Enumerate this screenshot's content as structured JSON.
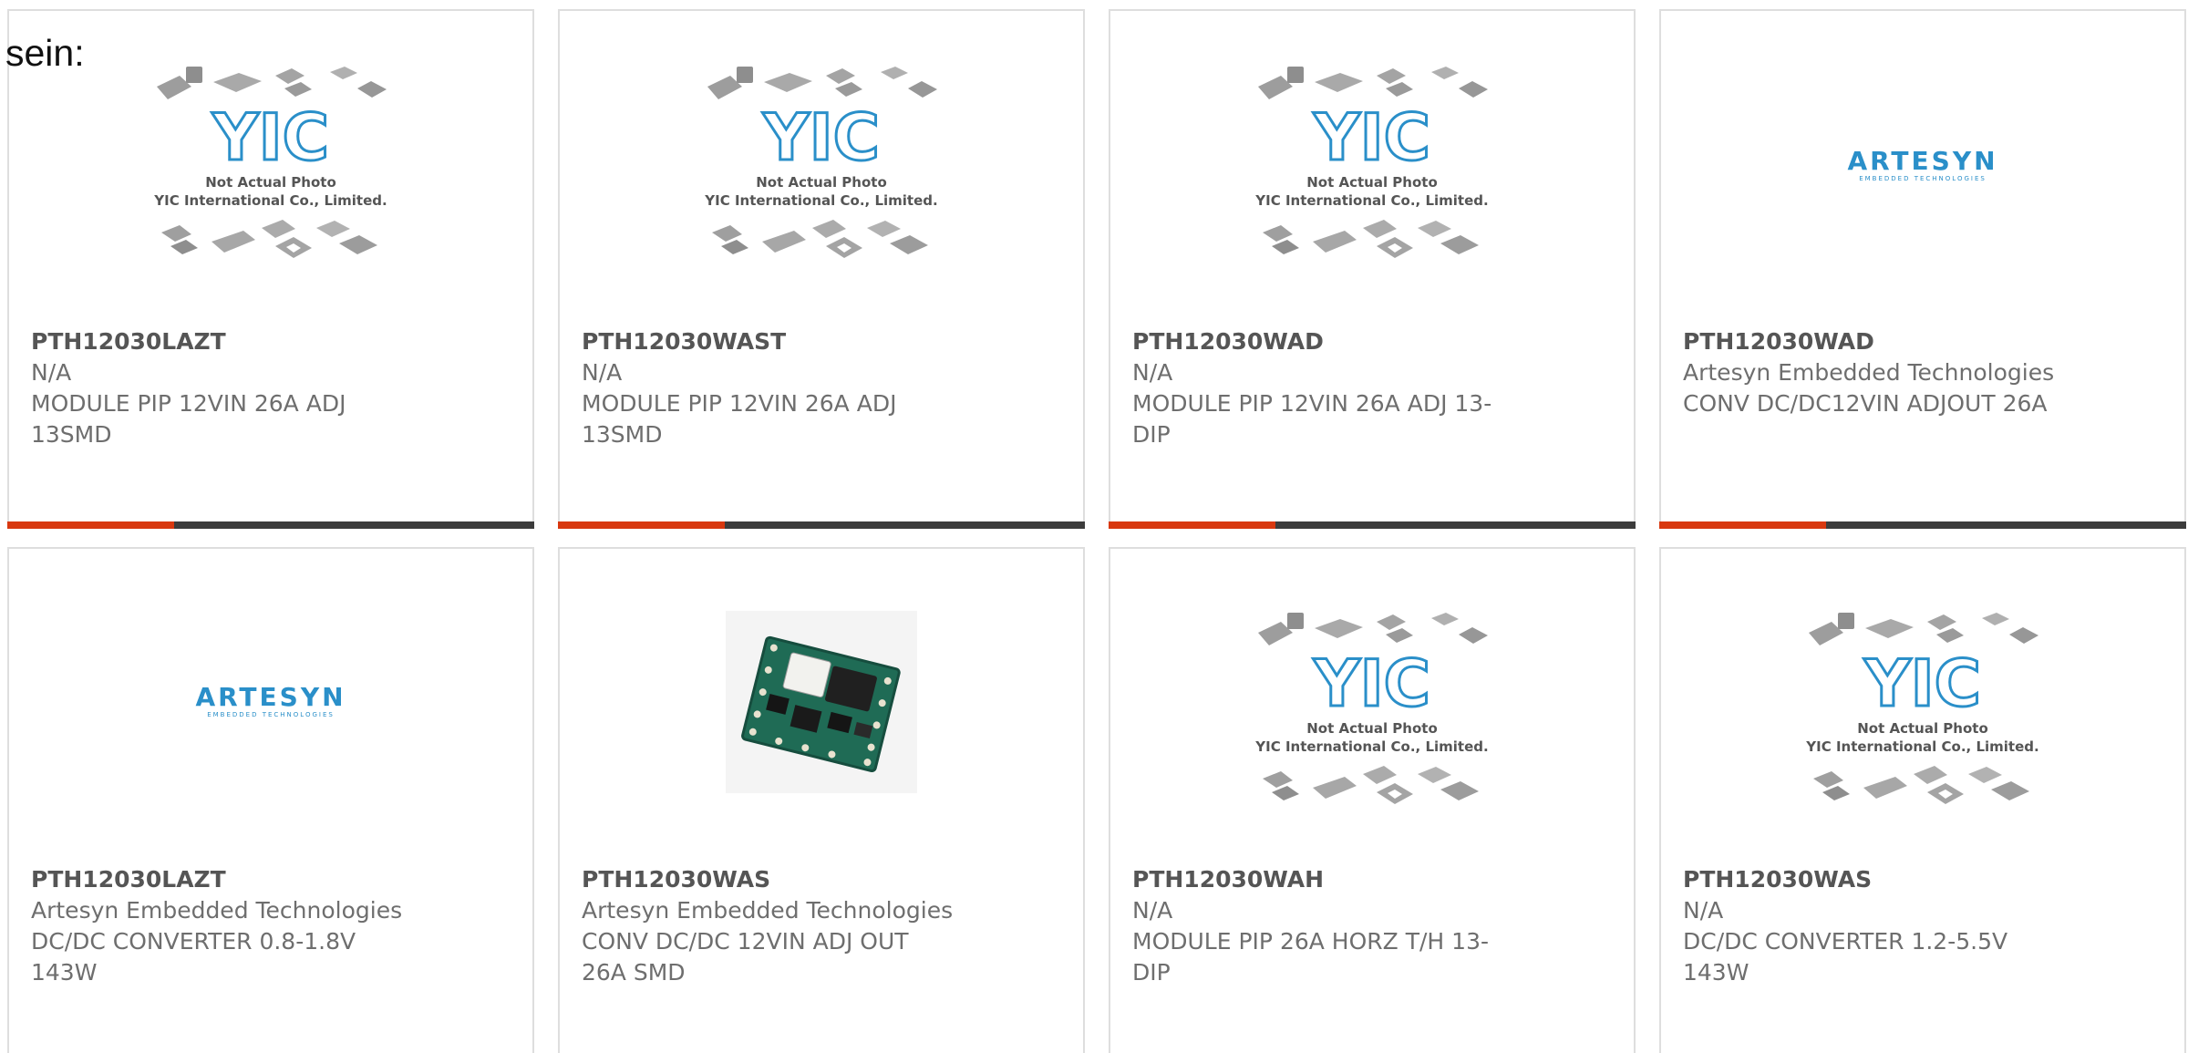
{
  "page": {
    "heading": "sein:"
  },
  "placeholder_image": {
    "line1": "Not Actual Photo",
    "line2": "YIC International Co., Limited.",
    "logo": "YIC"
  },
  "artesyn_logo": {
    "brand": "ARTESYN",
    "tagline": "EMBEDDED TECHNOLOGIES"
  },
  "colors": {
    "accent": "#d8380f",
    "bar": "#3c3c3c",
    "border": "#dedede",
    "text": "#6e6e6e",
    "logo_blue": "#2a8fc9"
  },
  "products": [
    {
      "part_number": "PTH12030LAZT",
      "manufacturer": "N/A",
      "description": "MODULE PIP 12VIN 26A ADJ 13SMD",
      "image": "yic-placeholder"
    },
    {
      "part_number": "PTH12030WAST",
      "manufacturer": "N/A",
      "description": "MODULE PIP 12VIN 26A ADJ 13SMD",
      "image": "yic-placeholder"
    },
    {
      "part_number": "PTH12030WAD",
      "manufacturer": "N/A",
      "description": "MODULE PIP 12VIN 26A ADJ 13-DIP",
      "image": "yic-placeholder"
    },
    {
      "part_number": "PTH12030WAD",
      "manufacturer": "Artesyn Embedded Technologies",
      "description": "CONV DC/DC12VIN ADJOUT 26A",
      "image": "artesyn-logo"
    },
    {
      "part_number": "PTH12030LAZT",
      "manufacturer": "Artesyn Embedded Technologies",
      "description": "DC/DC CONVERTER 0.8-1.8V 143W",
      "image": "artesyn-logo"
    },
    {
      "part_number": "PTH12030WAS",
      "manufacturer": "Artesyn Embedded Technologies",
      "description": "CONV DC/DC 12VIN ADJ OUT 26A SMD",
      "image": "pcb-module-photo"
    },
    {
      "part_number": "PTH12030WAH",
      "manufacturer": "N/A",
      "description": "MODULE PIP 26A HORZ T/H 13-DIP",
      "image": "yic-placeholder"
    },
    {
      "part_number": "PTH12030WAS",
      "manufacturer": "N/A",
      "description": "DC/DC CONVERTER 1.2-5.5V 143W",
      "image": "yic-placeholder"
    }
  ]
}
